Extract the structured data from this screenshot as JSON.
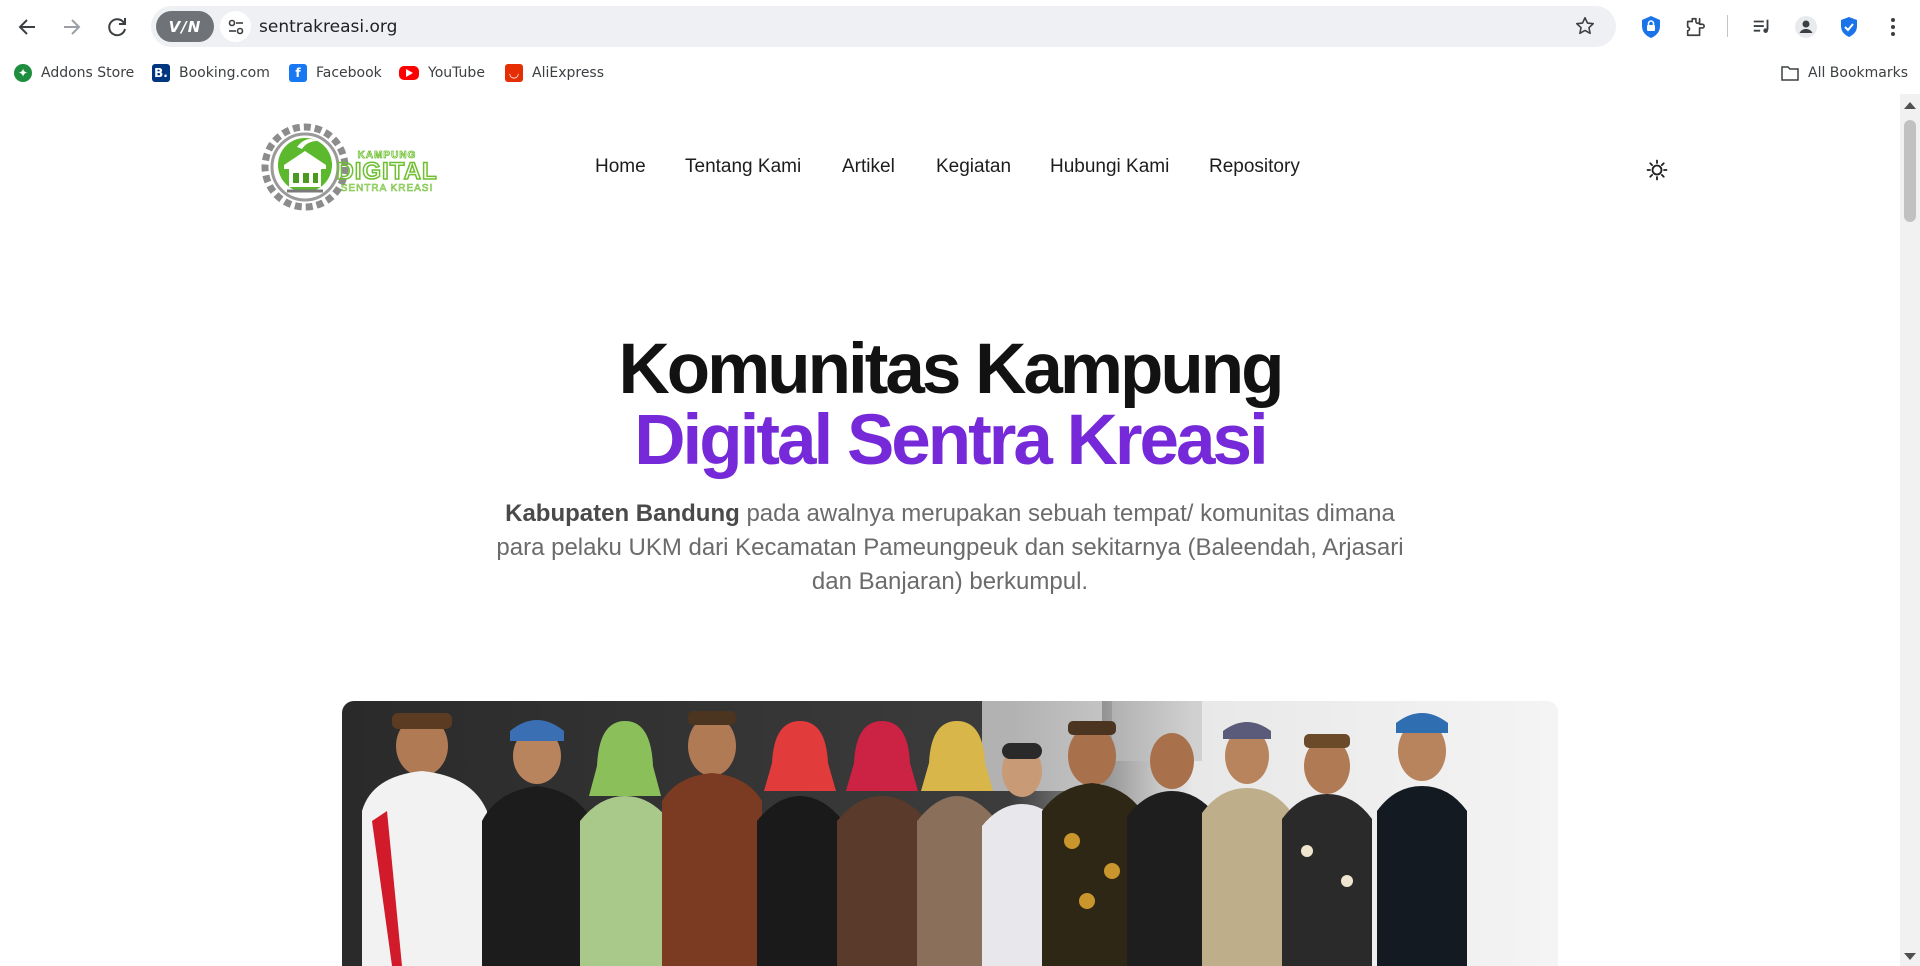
{
  "browser": {
    "url": "sentrakreasi.org",
    "vpn_label": "V/N",
    "bookmarks": [
      {
        "label": "Addons Store",
        "icon": "addons-store-icon",
        "color": "#1e8e3e"
      },
      {
        "label": "Booking.com",
        "icon": "booking-icon",
        "color": "#003580"
      },
      {
        "label": "Facebook",
        "icon": "facebook-icon",
        "color": "#1877f2"
      },
      {
        "label": "YouTube",
        "icon": "youtube-icon",
        "color": "#ff0000"
      },
      {
        "label": "AliExpress",
        "icon": "aliexpress-icon",
        "color": "#e62e04"
      }
    ],
    "all_bookmarks_label": "All Bookmarks"
  },
  "site": {
    "logo": {
      "line1": "KAMPUNG",
      "line2": "DIGITAL",
      "line3": "SENTRA KREASI",
      "brand_green": "#6dbf2e",
      "gear_gray": "#8c8c8c"
    },
    "nav": [
      "Home",
      "Tentang Kami",
      "Artikel",
      "Kegiatan",
      "Hubungi Kami",
      "Repository"
    ],
    "hero": {
      "title_line1": "Komunitas Kampung",
      "title_line2": "Digital Sentra Kreasi",
      "accent_color": "#7629d8",
      "desc_bold": "Kabupaten Bandung",
      "desc_rest": " pada awalnya merupakan sebuah tempat/ komunitas dimana para pelaku UKM dari Kecamatan Pameungpeuk dan sekitarnya (Baleendah, Arjasari dan Banjaran) berkumpul."
    }
  }
}
